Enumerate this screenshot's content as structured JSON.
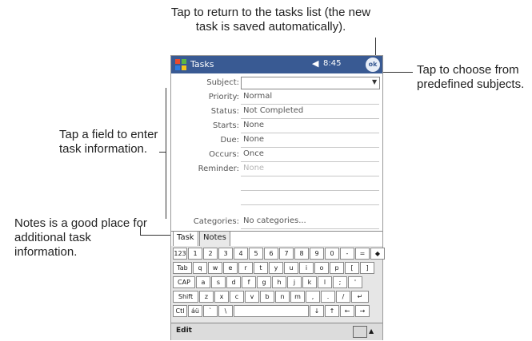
{
  "callouts": {
    "top": "Tap to return to the tasks list (the new task is saved automatically).",
    "right": "Tap to choose from predefined subjects.",
    "left1": "Tap a field to enter task information.",
    "left2": "Notes is a good place for additional task information."
  },
  "device": {
    "app_title": "Tasks",
    "clock": "8:45",
    "ok_label": "ok",
    "fields": [
      {
        "label": "Subject:",
        "value": ""
      },
      {
        "label": "Priority:",
        "value": "Normal"
      },
      {
        "label": "Status:",
        "value": "Not Completed"
      },
      {
        "label": "Starts:",
        "value": "None"
      },
      {
        "label": "Due:",
        "value": "None"
      },
      {
        "label": "Occurs:",
        "value": "Once"
      },
      {
        "label": "Reminder:",
        "value": "None"
      },
      {
        "label": "Categories:",
        "value": "No categories..."
      }
    ],
    "tabs": [
      "Task",
      "Notes"
    ],
    "keyboard": {
      "row1": [
        "123",
        "1",
        "2",
        "3",
        "4",
        "5",
        "6",
        "7",
        "8",
        "9",
        "0",
        "-",
        "=",
        "◆"
      ],
      "row2": [
        "Tab",
        "q",
        "w",
        "e",
        "r",
        "t",
        "y",
        "u",
        "i",
        "o",
        "p",
        "[",
        "]"
      ],
      "row3": [
        "CAP",
        "a",
        "s",
        "d",
        "f",
        "g",
        "h",
        "j",
        "k",
        "l",
        ";",
        "'"
      ],
      "row4": [
        "Shift",
        "z",
        "x",
        "c",
        "v",
        "b",
        "n",
        "m",
        ",",
        ".",
        "/",
        "↵"
      ],
      "row5": [
        "Ctl",
        "áü",
        "`",
        "\\",
        "↓",
        "↑",
        "←",
        "→"
      ]
    },
    "menu_edit": "Edit"
  }
}
